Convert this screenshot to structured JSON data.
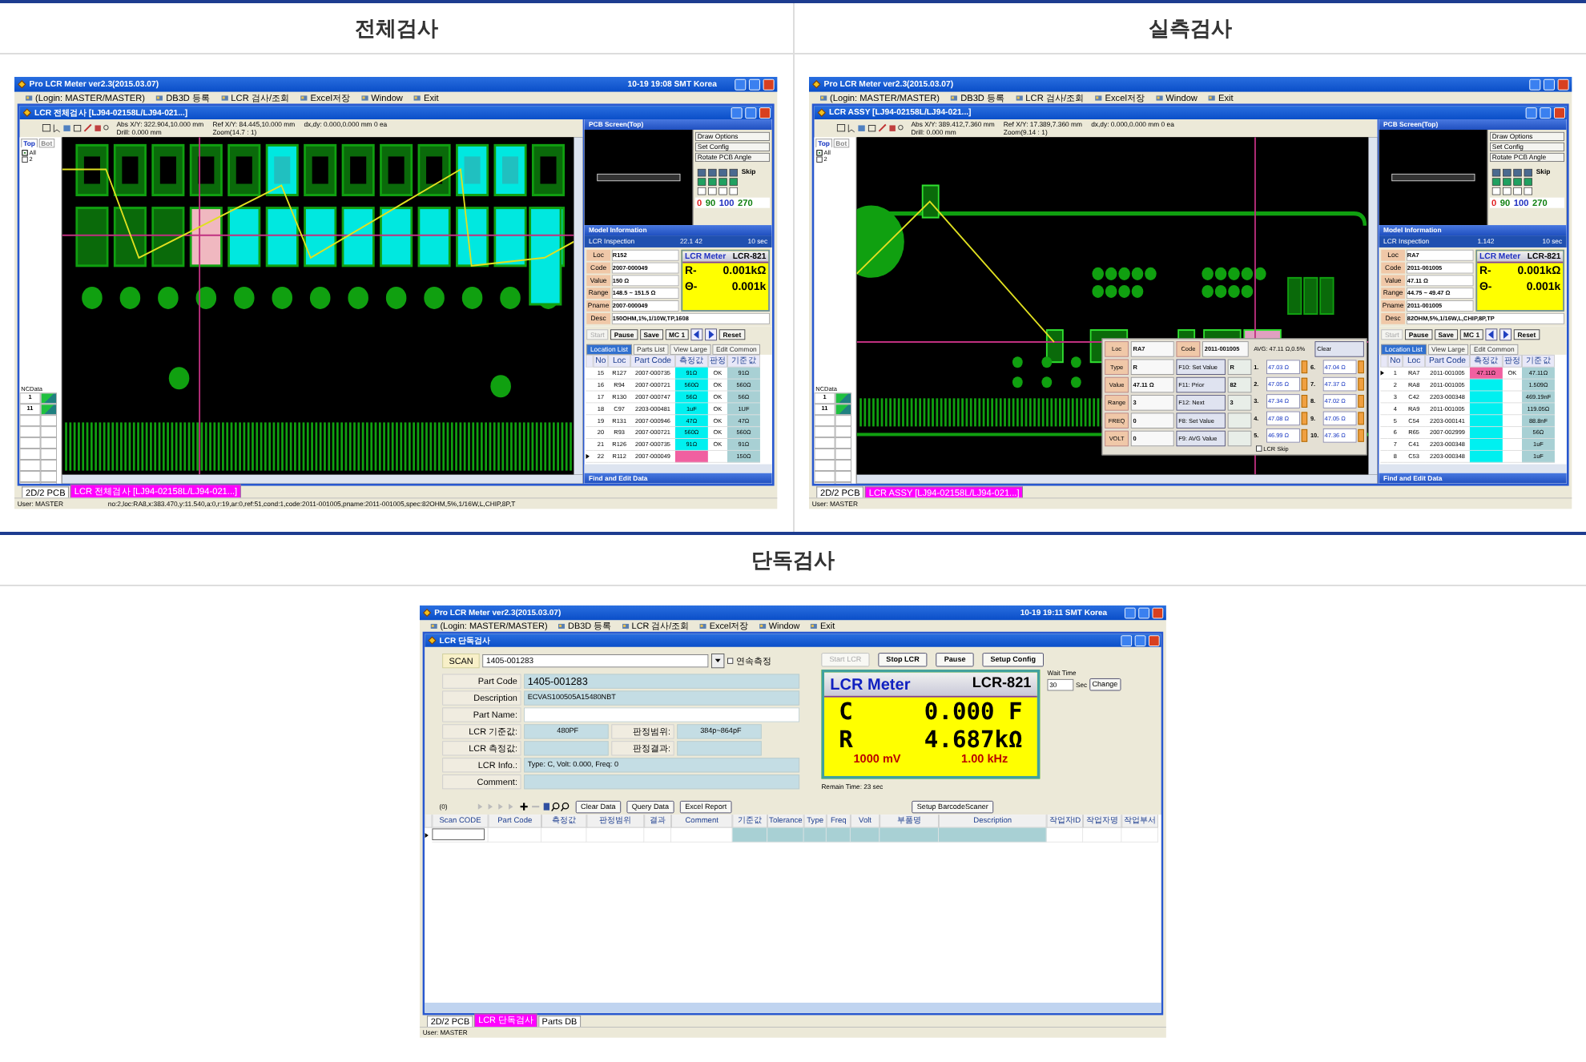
{
  "sections": [
    {
      "heading": "전체검사",
      "app": {
        "title": "Pro LCR Meter ver2.3(2015.03.07)",
        "clock": "10-19 19:08 SMT Korea",
        "menu": [
          "(Login: MASTER/MASTER)",
          "DB3D 등록",
          "LCR 검사/조회",
          "Excel저장",
          "Window",
          "Exit"
        ],
        "child_title": "LCR 전체검사 [LJ94-02158L/LJ94-021...]",
        "toolbar_info": [
          "Abs X/Y: 322.904,10.000 mm",
          "Ref X/Y: 84.445,10.000 mm",
          "dx,dy: 0.000,0.000 mm 0 ea",
          "Drill: 0.000 mm",
          "Zoom(14.7 : 1)"
        ],
        "layer_tabs": [
          {
            "label": "Top",
            "selected": true
          },
          {
            "label": "Bot",
            "selected": false
          }
        ],
        "layer_checks": [
          {
            "label": "All",
            "checked": true
          },
          {
            "label": "2",
            "checked": false
          }
        ],
        "nc_label": "NCData",
        "nc_rows": [
          "1",
          "11"
        ],
        "canvas": {
          "kind": "full"
        },
        "screen_title": "PCB Screen(Top)",
        "screen_buttons": [
          "Draw Options",
          "Set Config",
          "Rotate PCB Angle"
        ],
        "skip_label": "Skip",
        "counts": [
          {
            "text": "0",
            "color": "#e02020"
          },
          {
            "text": "90",
            "color": "#108010"
          },
          {
            "text": "100",
            "color": "#2030c0"
          },
          {
            "text": "270",
            "color": "#108010"
          }
        ],
        "model_title": "Model Information",
        "inspection": {
          "label": "LCR Inspection",
          "time": "22.1 42",
          "unit": "10 sec"
        },
        "fields": [
          {
            "label": "Loc",
            "value": "R152"
          },
          {
            "label": "Code",
            "value": "2007-000049"
          },
          {
            "label": "Value",
            "value": "150 Ω"
          },
          {
            "label": "Range",
            "value": "148.5 ~ 151.5 Ω"
          },
          {
            "label": "Pname",
            "value": "2007-000049"
          },
          {
            "label": "Desc",
            "value": "150OHM,1%,1/10W,TP,1608"
          }
        ],
        "meter": {
          "title": "LCR Meter",
          "model": "LCR-821",
          "lines": [
            {
              "sym": "R-",
              "value": "0.001kΩ"
            },
            {
              "sym": "Θ-",
              "value": "0.001k"
            }
          ]
        },
        "controls": [
          {
            "label": "Start",
            "disabled": true
          },
          {
            "label": "Pause",
            "disabled": false
          },
          {
            "label": "Save",
            "disabled": false
          },
          {
            "label": "MC 1",
            "disabled": false
          },
          {
            "label": "Reset",
            "disabled": false
          }
        ],
        "list_tabs": [
          {
            "label": "Location List",
            "selected": true
          },
          {
            "label": "Parts List",
            "selected": false
          },
          {
            "label": "View Large",
            "selected": false
          },
          {
            "label": "Edit Common",
            "selected": false
          }
        ],
        "columns": [
          "No",
          "Loc",
          "Part Code",
          "측정값",
          "판정",
          "기준값"
        ],
        "rows": [
          {
            "cells": [
              "15",
              "R127",
              "2007-000735",
              "91Ω",
              "OK",
              "91Ω"
            ],
            "selected": false
          },
          {
            "cells": [
              "16",
              "R94",
              "2007-000721",
              "560Ω",
              "OK",
              "560Ω"
            ],
            "selected": false
          },
          {
            "cells": [
              "17",
              "R130",
              "2007-000747",
              "56Ω",
              "OK",
              "56Ω"
            ],
            "selected": false
          },
          {
            "cells": [
              "18",
              "C97",
              "2203-000481",
              "1uF",
              "OK",
              "1UF"
            ],
            "selected": false
          },
          {
            "cells": [
              "19",
              "R131",
              "2007-000946",
              "47Ω",
              "OK",
              "47Ω"
            ],
            "selected": false
          },
          {
            "cells": [
              "20",
              "R93",
              "2007-000721",
              "560Ω",
              "OK",
              "560Ω"
            ],
            "selected": false
          },
          {
            "cells": [
              "21",
              "R126",
              "2007-000735",
              "91Ω",
              "OK",
              "91Ω"
            ],
            "selected": false
          },
          {
            "cells": [
              "22",
              "R112",
              "2007-000049",
              "",
              "",
              "150Ω"
            ],
            "selected": true
          }
        ],
        "find_label": "Find and Edit Data",
        "doc_tabs": [
          {
            "label": "2D/2 PCB",
            "selected": false
          },
          {
            "label": "LCR 전체검사 [LJ94-02158L/LJ94-021...]",
            "selected": true
          }
        ],
        "status": [
          "User: MASTER",
          "no:2,loc:RA8,x:383.470,y:11.540,a:0,r:19,ar:0,ref:51,cond:1,code:2011-001005,pname:2011-001005,spec:82OHM,5%,1/16W,L,CHIP,8P,T"
        ]
      }
    },
    {
      "heading": "실측검사",
      "app": {
        "title": "Pro LCR Meter ver2.3(2015.03.07)",
        "menu": [
          "(Login: MASTER/MASTER)",
          "DB3D 등록",
          "LCR 검사/조회",
          "Excel저장",
          "Window",
          "Exit"
        ],
        "child_title": "LCR ASSY [LJ94-02158L/LJ94-021...]",
        "toolbar_info": [
          "Abs X/Y: 389.412,7.360 mm",
          "Ref X/Y: 17.389,7.360 mm",
          "dx,dy: 0.000,0.000 mm 0 ea",
          "Drill: 0.000 mm",
          "Zoom(9.14 : 1)"
        ],
        "layer_tabs": [
          {
            "label": "Top",
            "selected": true
          },
          {
            "label": "Bot",
            "selected": false
          }
        ],
        "layer_checks": [
          {
            "label": "All",
            "checked": true
          },
          {
            "label": "2",
            "checked": false
          }
        ],
        "nc_label": "NCData",
        "nc_rows": [
          "1",
          "11"
        ],
        "canvas": {
          "kind": "assy"
        },
        "popup": {
          "fields": [
            {
              "label": "Loc",
              "value": "RA7"
            },
            {
              "label": "Type",
              "value": "R"
            },
            {
              "label": "Value",
              "value": "47.11 Ω"
            },
            {
              "label": "Range",
              "value": "3"
            },
            {
              "label": "FREQ",
              "value": "0"
            },
            {
              "label": "VOLT",
              "value": "0"
            }
          ],
          "code_label": "Code",
          "code": "2011-001005",
          "keys": [
            {
              "label": "F10: Set Value",
              "value": "R"
            },
            {
              "label": "F11: Prior",
              "value": "82"
            },
            {
              "label": "F12: Next",
              "value": "3"
            },
            {
              "label": "F8: Set Value"
            },
            {
              "label": "F9: AVG Value"
            }
          ],
          "skip": {
            "label": "LCR Skip",
            "checked": false
          },
          "avg": "AVG: 47.11 Ω,0.5%",
          "clear": "Clear",
          "readings": [
            {
              "n": "1.",
              "value": "47.03 Ω"
            },
            {
              "n": "2.",
              "value": "47.05 Ω"
            },
            {
              "n": "3.",
              "value": "47.34 Ω"
            },
            {
              "n": "4.",
              "value": "47.08 Ω"
            },
            {
              "n": "5.",
              "value": "46.99 Ω"
            },
            {
              "n": "6.",
              "value": "47.04 Ω"
            },
            {
              "n": "7.",
              "value": "47.37 Ω"
            },
            {
              "n": "8.",
              "value": "47.02 Ω"
            },
            {
              "n": "9.",
              "value": "47.05 Ω"
            },
            {
              "n": "10.",
              "value": "47.36 Ω"
            }
          ]
        },
        "screen_title": "PCB Screen(Top)",
        "screen_buttons": [
          "Draw Options",
          "Set Config",
          "Rotate PCB Angle"
        ],
        "skip_label": "Skip",
        "counts": [
          {
            "text": "0",
            "color": "#e02020"
          },
          {
            "text": "90",
            "color": "#108010"
          },
          {
            "text": "100",
            "color": "#2030c0"
          },
          {
            "text": "270",
            "color": "#108010"
          }
        ],
        "model_title": "Model Information",
        "inspection": {
          "label": "LCR Inspection",
          "time": "1.142",
          "unit": "10 sec"
        },
        "fields": [
          {
            "label": "Loc",
            "value": "RA7"
          },
          {
            "label": "Code",
            "value": "2011-001005"
          },
          {
            "label": "Value",
            "value": "47.11 Ω"
          },
          {
            "label": "Range",
            "value": "44.75 ~ 49.47 Ω"
          },
          {
            "label": "Pname",
            "value": "2011-001005"
          },
          {
            "label": "Desc",
            "value": "82OHM,5%,1/16W,L,CHIP,8P,TP"
          }
        ],
        "meter": {
          "title": "LCR Meter",
          "model": "LCR-821",
          "lines": [
            {
              "sym": "R-",
              "value": "0.001kΩ"
            },
            {
              "sym": "Θ-",
              "value": "0.001k"
            }
          ]
        },
        "controls": [
          {
            "label": "Start",
            "disabled": true
          },
          {
            "label": "Pause",
            "disabled": false
          },
          {
            "label": "Save",
            "disabled": false
          },
          {
            "label": "MC 1",
            "disabled": false
          },
          {
            "label": "Reset",
            "disabled": false
          }
        ],
        "list_tabs": [
          {
            "label": "Location List",
            "selected": true
          },
          {
            "label": "View Large",
            "selected": false
          },
          {
            "label": "Edit Common",
            "selected": false
          }
        ],
        "columns": [
          "No",
          "Loc",
          "Part Code",
          "측정값",
          "판정",
          "기준값"
        ],
        "rows": [
          {
            "cells": [
              "1",
              "RA7",
              "2011-001005",
              "47.11Ω",
              "OK",
              "47.11Ω"
            ],
            "selected": true
          },
          {
            "cells": [
              "2",
              "RA8",
              "2011-001005",
              "",
              "",
              "1.509Ω"
            ],
            "selected": false
          },
          {
            "cells": [
              "3",
              "C42",
              "2203-000348",
              "",
              "",
              "469.19nF"
            ],
            "selected": false
          },
          {
            "cells": [
              "4",
              "RA9",
              "2011-001005",
              "",
              "",
              "119.05Ω"
            ],
            "selected": false
          },
          {
            "cells": [
              "5",
              "C54",
              "2203-000141",
              "",
              "",
              "88.8nF"
            ],
            "selected": false
          },
          {
            "cells": [
              "6",
              "R65",
              "2007-002999",
              "",
              "",
              "56Ω"
            ],
            "selected": false
          },
          {
            "cells": [
              "7",
              "C41",
              "2203-000348",
              "",
              "",
              "1uF"
            ],
            "selected": false
          },
          {
            "cells": [
              "8",
              "C53",
              "2203-000348",
              "",
              "",
              "1uF"
            ],
            "selected": false
          }
        ],
        "find_label": "Find and Edit Data",
        "doc_tabs": [
          {
            "label": "2D/2 PCB",
            "selected": false
          },
          {
            "label": "LCR ASSY [LJ94-02158L/LJ94-021...]",
            "selected": true
          }
        ],
        "status": [
          "User: MASTER"
        ]
      }
    }
  ],
  "single": {
    "heading": "단독검사",
    "app": {
      "title": "Pro LCR Meter ver2.3(2015.03.07)",
      "clock": "10-19 19:11 SMT Korea",
      "menu": [
        "(Login: MASTER/MASTER)",
        "DB3D 등록",
        "LCR 검사/조회",
        "Excel저장",
        "Window",
        "Exit"
      ],
      "child_title": "LCR 단독검사",
      "scan_label": "SCAN",
      "scan_value": "1405-001283",
      "continuous": {
        "label": "연속측정",
        "checked": false
      },
      "form": [
        {
          "label": "Part Code",
          "value": "1405-001283"
        },
        {
          "label": "Description",
          "value": "ECVAS100505A15480NBT"
        },
        {
          "label": "Part Name:"
        },
        {
          "label": "LCR 기준값:",
          "value": "480PF",
          "label2": "판정범위:",
          "value2": "384p~864pF"
        },
        {
          "label": "LCR 측정값:",
          "label2": "판정결과:"
        },
        {
          "label": "LCR Info.:",
          "value": "Type: C, Volt: 0.000, Freq: 0"
        },
        {
          "label": "Comment:"
        }
      ],
      "buttons": [
        {
          "label": "Start LCR",
          "disabled": true
        },
        {
          "label": "Stop LCR",
          "disabled": false
        },
        {
          "label": "Pause",
          "disabled": false
        },
        {
          "label": "Setup Config",
          "disabled": false
        }
      ],
      "meter": {
        "title": "LCR Meter",
        "model": "LCR-821",
        "lines": [
          {
            "sym": "C",
            "value": "0.000 F"
          },
          {
            "sym": "R",
            "value": "4.687kΩ"
          }
        ],
        "footer": [
          "1000 mV",
          "1.00 kHz"
        ]
      },
      "wait": {
        "label": "Wait Time",
        "value": "30",
        "unit": "Sec",
        "button": "Change"
      },
      "remain": "Remain Time: 23 sec",
      "record_count": "(0)",
      "grid_buttons": [
        "Clear Data",
        "Query Data",
        "Excel Report",
        "Setup BarcodeScaner"
      ],
      "columns": [
        {
          "label": "Scan CODE",
          "shaded": false
        },
        {
          "label": "Part Code",
          "shaded": false
        },
        {
          "label": "측정값",
          "shaded": false
        },
        {
          "label": "판정범위",
          "shaded": false
        },
        {
          "label": "결과",
          "shaded": false
        },
        {
          "label": "Comment",
          "shaded": false
        },
        {
          "label": "기준값",
          "shaded": true
        },
        {
          "label": "Tolerance",
          "shaded": true
        },
        {
          "label": "Type",
          "shaded": true
        },
        {
          "label": "Freq",
          "shaded": true
        },
        {
          "label": "Volt",
          "shaded": true
        },
        {
          "label": "부품명",
          "shaded": true
        },
        {
          "label": "Description",
          "shaded": true
        },
        {
          "label": "작업자ID",
          "shaded": false
        },
        {
          "label": "작업자명",
          "shaded": false
        },
        {
          "label": "작업부서",
          "shaded": false
        }
      ],
      "doc_tabs": [
        {
          "label": "2D/2 PCB",
          "selected": false
        },
        {
          "label": "LCR 단독검사",
          "selected": true
        },
        {
          "label": "Parts DB",
          "selected": false
        }
      ],
      "status": [
        "User: MASTER"
      ]
    }
  }
}
